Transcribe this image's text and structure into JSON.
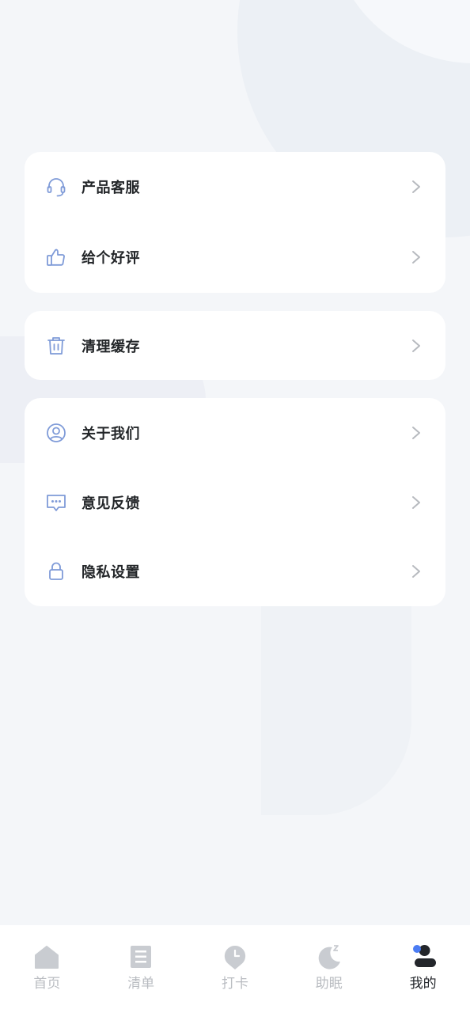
{
  "menu": {
    "group1": [
      {
        "label": "产品客服",
        "icon": "headset-icon"
      },
      {
        "label": "给个好评",
        "icon": "thumbs-up-icon"
      }
    ],
    "group2": [
      {
        "label": "清理缓存",
        "icon": "trash-icon"
      }
    ],
    "group3": [
      {
        "label": "关于我们",
        "icon": "user-circle-icon"
      },
      {
        "label": "意见反馈",
        "icon": "chat-bubble-icon"
      },
      {
        "label": "隐私设置",
        "icon": "lock-icon"
      }
    ]
  },
  "tabbar": {
    "items": [
      {
        "label": "首页",
        "icon": "home-icon"
      },
      {
        "label": "清单",
        "icon": "list-icon"
      },
      {
        "label": "打卡",
        "icon": "clock-pin-icon"
      },
      {
        "label": "助眠",
        "icon": "moon-icon"
      },
      {
        "label": "我的",
        "icon": "profile-icon"
      }
    ],
    "active_index": 4
  },
  "colors": {
    "accent_blue": "#7f9bd8",
    "active_dot": "#4b7cf3",
    "chevron": "#b7babf",
    "tab_inactive": "#c9ccd1",
    "text_primary": "#232629"
  }
}
